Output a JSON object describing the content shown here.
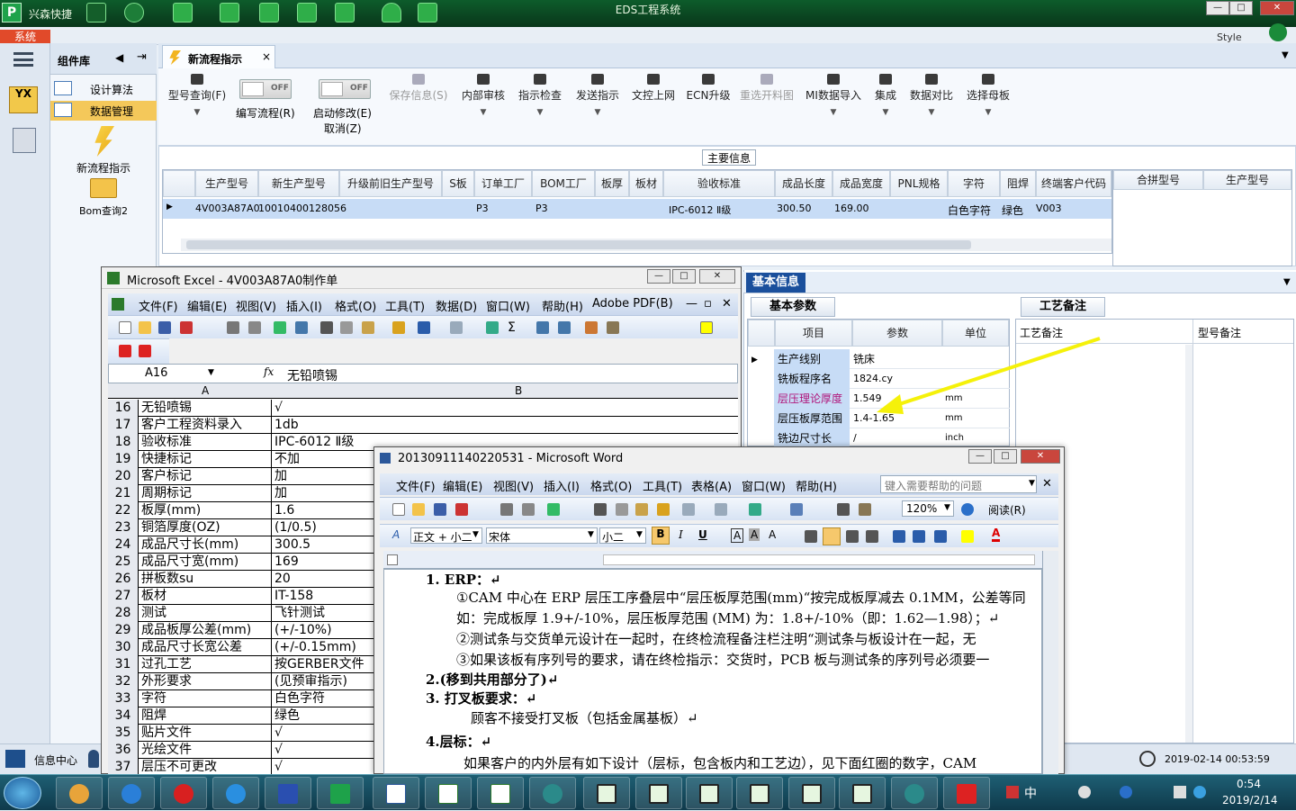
{
  "titlebar": {
    "app_name": "兴森快捷",
    "title": "EDS工程系统",
    "system_tab": "系统",
    "style_label": "Style"
  },
  "component_panel": {
    "header": "组件库",
    "items": [
      {
        "label": "设计算法"
      },
      {
        "label": "数据管理"
      }
    ],
    "tools": [
      {
        "label": "新流程指示"
      },
      {
        "label": "Bom查询2"
      }
    ]
  },
  "left_strip": {
    "bottom_label": "信息中心"
  },
  "tab": {
    "label": "新流程指示",
    "close": "×"
  },
  "toolbar": {
    "buttons": [
      {
        "label": "型号查询(F)"
      },
      {
        "label": "编写流程(R)",
        "toggle": "OFF"
      },
      {
        "label": "启动修改(E)",
        "sub": "取消(Z)",
        "toggle": "OFF"
      },
      {
        "label": "保存信息(S)"
      },
      {
        "label": "内部审核"
      },
      {
        "label": "指示检查"
      },
      {
        "label": "发送指示"
      },
      {
        "label": "文控上网"
      },
      {
        "label": "ECN升级"
      },
      {
        "label": "重选开料图"
      },
      {
        "label": "MI数据导入"
      },
      {
        "label": "集成"
      },
      {
        "label": "数据对比"
      },
      {
        "label": "选择母板"
      }
    ]
  },
  "main_info": {
    "title": "主要信息",
    "columns": [
      "生产型号",
      "新生产型号",
      "升级前旧生产型号",
      "S板",
      "订单工厂",
      "BOM工厂",
      "板厚",
      "板材",
      "验收标准",
      "成品长度",
      "成品宽度",
      "PNL规格",
      "字符",
      "阻焊",
      "终端客户代码",
      "合拼型号",
      "生产型号"
    ],
    "row": [
      "4V003A87A0",
      "10010400128056",
      "",
      "",
      "P3",
      "P3",
      "",
      "",
      "IPC-6012 Ⅱ级",
      "300.50",
      "169.00",
      "",
      "白色字符",
      "绿色",
      "V003"
    ]
  },
  "basic_info": {
    "title": "基本信息",
    "tab_params": "基本参数",
    "tab_notes": "工艺备注",
    "cols": [
      "项目",
      "参数",
      "单位"
    ],
    "rows": [
      {
        "name": "生产线别",
        "value": "铣床",
        "unit": ""
      },
      {
        "name": "铣板程序名",
        "value": "1824.cy",
        "unit": ""
      },
      {
        "name": "层压理论厚度",
        "value": "1.549",
        "unit": "mm"
      },
      {
        "name": "层压板厚范围",
        "value": "1.4-1.65",
        "unit": "mm"
      },
      {
        "name": "铣边尺寸长",
        "value": "/",
        "unit": "inch"
      }
    ],
    "notes_cols": [
      "工艺备注",
      "型号备注"
    ],
    "datetime": "2019-02-14 00:53:59"
  },
  "excel": {
    "title": "Microsoft Excel - 4V003A87A0制作单",
    "menu": [
      "文件(F)",
      "编辑(E)",
      "视图(V)",
      "插入(I)",
      "格式(O)",
      "工具(T)",
      "数据(D)",
      "窗口(W)",
      "帮助(H)",
      "Adobe PDF(B)"
    ],
    "cell_ref": "A16",
    "formula": "无铅喷锡",
    "col_a": "A",
    "col_b": "B",
    "rows": [
      {
        "n": "16",
        "a": "无铅喷锡",
        "b": "√"
      },
      {
        "n": "17",
        "a": "客户工程资料录入",
        "b": "1db"
      },
      {
        "n": "18",
        "a": "验收标准",
        "b": "IPC-6012 Ⅱ级"
      },
      {
        "n": "19",
        "a": "快捷标记",
        "b": "不加"
      },
      {
        "n": "20",
        "a": "客户标记",
        "b": "加"
      },
      {
        "n": "21",
        "a": "周期标记",
        "b": "加"
      },
      {
        "n": "22",
        "a": "板厚(mm)",
        "b": "1.6"
      },
      {
        "n": "23",
        "a": "铜箔厚度(OZ)",
        "b": "(1/0.5)"
      },
      {
        "n": "24",
        "a": "成品尺寸长(mm)",
        "b": "300.5"
      },
      {
        "n": "25",
        "a": "成品尺寸宽(mm)",
        "b": "169"
      },
      {
        "n": "26",
        "a": "拼板数su",
        "b": "20"
      },
      {
        "n": "27",
        "a": "板材",
        "b": "IT-158"
      },
      {
        "n": "28",
        "a": "测试",
        "b": "飞针测试"
      },
      {
        "n": "29",
        "a": "成品板厚公差(mm)",
        "b": "(+/-10%)"
      },
      {
        "n": "30",
        "a": "成品尺寸长宽公差",
        "b": "(+/-0.15mm)"
      },
      {
        "n": "31",
        "a": "过孔工艺",
        "b": "按GERBER文件"
      },
      {
        "n": "32",
        "a": "外形要求",
        "b": "(见预审指示)"
      },
      {
        "n": "33",
        "a": "字符",
        "b": "白色字符"
      },
      {
        "n": "34",
        "a": "阻焊",
        "b": "绿色"
      },
      {
        "n": "35",
        "a": "贴片文件",
        "b": "√"
      },
      {
        "n": "36",
        "a": "光绘文件",
        "b": "√"
      },
      {
        "n": "37",
        "a": "层压不可更改",
        "b": "√"
      }
    ]
  },
  "word": {
    "title": "20130911140220531 - Microsoft Word",
    "menu": [
      "文件(F)",
      "编辑(E)",
      "视图(V)",
      "插入(I)",
      "格式(O)",
      "工具(T)",
      "表格(A)",
      "窗口(W)",
      "帮助(H)"
    ],
    "help_placeholder": "键入需要帮助的问题",
    "zoom": "120%",
    "read_label": "阅读(R)",
    "style": "正文 + 小二",
    "font": "宋体",
    "size": "小二",
    "lines": [
      "1.   ERP：↵",
      "①CAM 中心在 ERP 层压工序叠层中“层压板厚范围(mm)“按完成板厚减去 0.1MM，公差等同",
      "如：完成板厚 1.9+/-10%，层压板厚范围 (MM) 为：1.8+/-10%（即：1.62—1.98）；↵",
      "②测试条与交货单元设计在一起时，在终检流程备注栏注明“测试条与板设计在一起，无",
      "③如果该板有序列号的要求，请在终检指示：交货时，PCB 板与测试条的序列号必须要一",
      "2.(移到共用部分了)↵",
      "3.  打叉板要求：↵",
      "顾客不接受打叉板（包括金属基板）↵",
      "4.层标：↵",
      "如果客户的内外层有如下设计（层标，包含板内和工艺边），见下面红圈的数字，CAM"
    ]
  },
  "taskbar": {
    "time": "0:54",
    "date": "2019/2/14",
    "ime": "中"
  }
}
